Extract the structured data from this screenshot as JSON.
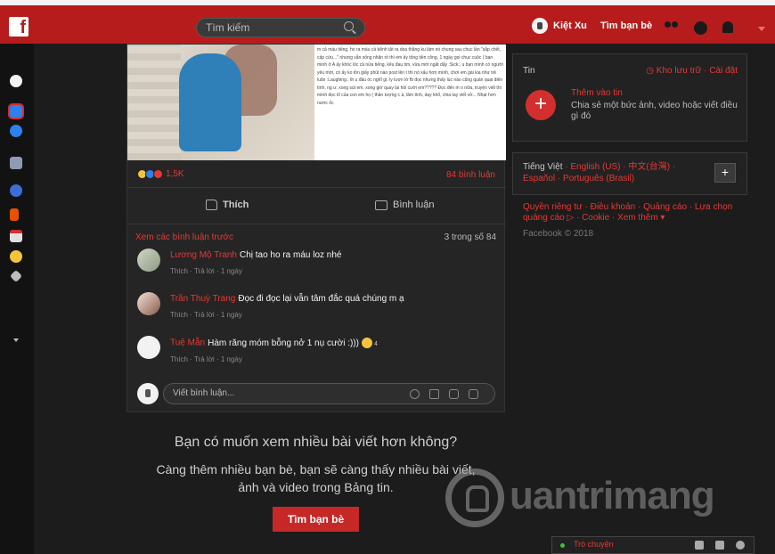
{
  "colors": {
    "accent": "#b71c1c",
    "link": "#e53935",
    "background": "#1c1c1c"
  },
  "header": {
    "logo": "f",
    "search_placeholder": "Tìm kiếm",
    "user_name": "Kiệt Xu",
    "friends_label": "Tìm bạn bè"
  },
  "post": {
    "image_text": "m cả máu tiếng, ho ra máu cả bệnh tật ra dọa thằng ku làm nó chung sau chục lần \"sắp chết, cấp cứu...\" nhưng vẫn sống nhăn rồ thì em ấy tống tiền công, 1 ngày gọi chục cuộc ( bạn mình ở A ấy khóc lóc cả nửa tiếng, kêu đau tim, vừa mới ngất dậy :Sick:, u bạn mình có người yêu mới, có ấy ko tồn giấy phút nào post lên t thì nó xấu hơn mình, chơi em gái kia như trẻ luân :Laughing:, th u đầu óc nghĩ gì. ly lượn lờ fb đọc nhưng thấy lúc nào cũng quản quại điên tình, ng ư, xong sút em, xong giờ quay lại hỏi cười em????? Đọc đến m o nữa, truyện viết thì mình đọc kĩ của con em họ ( thần tượng c à, lâm tình, dạy khổ, chia tay viết vở... Nhạt hơn nước ốc",
    "reaction_count": "1,5K",
    "comment_count": "84 bình luận",
    "like_label": "Thích",
    "comment_label": "Bình luận",
    "view_previous": "Xem các bình luận trước",
    "shown_of": "3 trong số 84",
    "comments": [
      {
        "name": "Lương Mộ Tranh",
        "text": "Chị tao ho ra máu loz nhé",
        "like": "Thích",
        "reply": "Trả lời",
        "time": "1 ngày"
      },
      {
        "name": "Trần Thuỳ Trang",
        "text": "Đọc đi đọc lại vẫn tâm đắc quá chúng m ạ",
        "like": "Thích",
        "reply": "Trả lời",
        "time": "1 ngày"
      },
      {
        "name": "Tuệ Mẫn",
        "text": "Hàm răng móm bỗng nở 1 nụ cười :)))",
        "reaction_count": "4",
        "like": "Thích",
        "reply": "Trả lời",
        "time": "1 ngày"
      }
    ],
    "write_placeholder": "Viết bình luận..."
  },
  "feed_end": {
    "question": "Bạn có muốn xem nhiều bài viết hơn không?",
    "suggestion_line1": "Càng thêm nhiều bạn bè, bạn sẽ càng thấy nhiều bài viết,",
    "suggestion_line2": "ảnh và video trong Bảng tin.",
    "button": "Tìm bạn bè"
  },
  "stories": {
    "title": "Tin",
    "archive": "Kho lưu trữ",
    "settings": "Cài đặt",
    "add": "Thêm vào tin",
    "desc": "Chia sẻ một bức ảnh, video hoặc viết điều gì đó"
  },
  "languages": {
    "current": "Tiếng Việt",
    "others": "English (US) · 中文(台灣) · Español · Português (Brasil)"
  },
  "footer": {
    "links": "Quyền riêng tư · Điều khoản · Quảng cáo · Lựa chọn quảng cáo ▷ · Cookie · Xem thêm ▾",
    "copyright": "Facebook © 2018"
  },
  "chat": {
    "label": "Trò chuyện"
  },
  "watermark": "uantrimang"
}
